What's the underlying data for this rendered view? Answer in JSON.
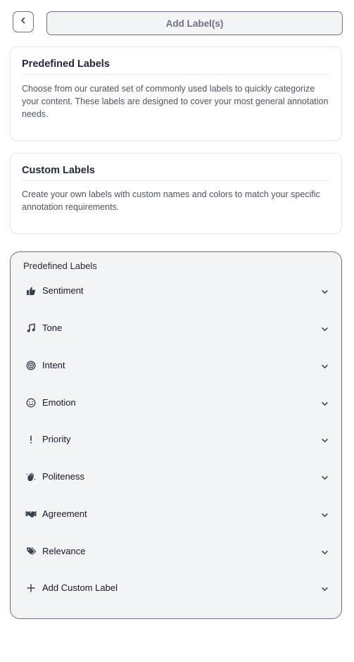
{
  "header": {
    "back_icon": "chevron-left-icon",
    "title_button_label": "Add Label(s)"
  },
  "info_cards": {
    "predefined": {
      "title": "Predefined Labels",
      "description": "Choose from our curated set of commonly used labels to quickly categorize your content. These labels are designed to cover your most general annotation needs."
    },
    "custom": {
      "title": "Custom Labels",
      "description": "Create your own labels with custom names and colors to match your specific annotation requirements."
    }
  },
  "labels_panel": {
    "title": "Predefined Labels",
    "items": [
      {
        "label": "Sentiment",
        "icon": "thumbs-up-icon"
      },
      {
        "label": "Tone",
        "icon": "music-note-icon"
      },
      {
        "label": "Intent",
        "icon": "target-icon"
      },
      {
        "label": "Emotion",
        "icon": "smiley-face-icon"
      },
      {
        "label": "Priority",
        "icon": "exclamation-icon"
      },
      {
        "label": "Politeness",
        "icon": "hand-wave-icon"
      },
      {
        "label": "Agreement",
        "icon": "handshake-icon"
      },
      {
        "label": "Relevance",
        "icon": "tags-icon"
      },
      {
        "label": "Add Custom Label",
        "icon": "plus-icon"
      }
    ]
  },
  "colors": {
    "panel_background": "#f3f4f6",
    "border": "#6b7280",
    "text_primary": "#1f2937",
    "text_muted": "#4b5563"
  }
}
